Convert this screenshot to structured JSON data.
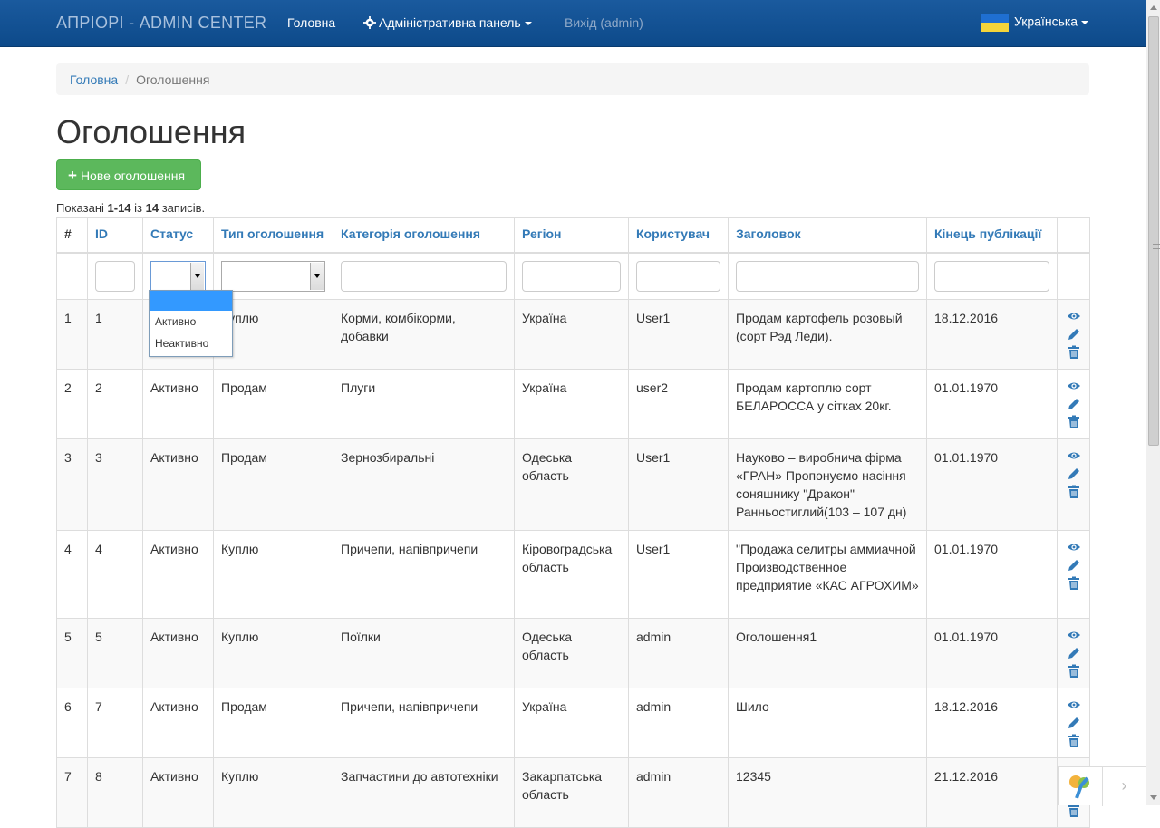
{
  "navbar": {
    "brand": "АПРІОРІ - ADMIN CENTER",
    "home": "Головна",
    "admin_panel": "Адміністративна панель",
    "logout": "Вихід (admin)",
    "language": "Українська"
  },
  "breadcrumb": {
    "home": "Головна",
    "current": "Оголошення"
  },
  "page_title": "Оголошення",
  "new_button": "Нове оголошення",
  "summary": {
    "prefix": "Показані ",
    "range": "1-14",
    "mid": " із ",
    "total": "14",
    "suffix": " записів."
  },
  "columns": [
    "#",
    "ID",
    "Статус",
    "Тип оголошення",
    "Категорія оголошення",
    "Регіон",
    "Користувач",
    "Заголовок",
    "Кінець публікації"
  ],
  "status_dropdown": {
    "options": [
      "",
      "Активно",
      "Неактивно"
    ]
  },
  "rows": [
    {
      "num": "1",
      "id": "1",
      "status": "",
      "type": "Куплю",
      "category": "Корми, комбікорми, добавки",
      "region": "Україна",
      "user": "User1",
      "title": "Продам картофель розовый (сорт Рэд Леди).",
      "end": "18.12.2016"
    },
    {
      "num": "2",
      "id": "2",
      "status": "Активно",
      "type": "Продам",
      "category": "Плуги",
      "region": "Україна",
      "user": "user2",
      "title": "Продам картоплю сорт БЕЛАРОССА у сітках 20кг.",
      "end": "01.01.1970"
    },
    {
      "num": "3",
      "id": "3",
      "status": "Активно",
      "type": "Продам",
      "category": "Зернозбиральні",
      "region": "Одеська область",
      "user": "User1",
      "title": "Науково – виробнича фірма «ГРАН» Пропонуємо насіння соняшнику \"Дракон\" Ранньостиглий(103 – 107 дн)",
      "end": "01.01.1970"
    },
    {
      "num": "4",
      "id": "4",
      "status": "Активно",
      "type": "Куплю",
      "category": "Причепи, напівпричепи",
      "region": "Кіровоградська область",
      "user": "User1",
      "title": "\"Продажа селитры аммиачной Производственное предприятие «КАС АГРОХИМ»",
      "end": "01.01.1970"
    },
    {
      "num": "5",
      "id": "5",
      "status": "Активно",
      "type": "Куплю",
      "category": "Поїлки",
      "region": "Одеська область",
      "user": "admin",
      "title": "Оголошення1",
      "end": "01.01.1970"
    },
    {
      "num": "6",
      "id": "7",
      "status": "Активно",
      "type": "Продам",
      "category": "Причепи, напівпричепи",
      "region": "Україна",
      "user": "admin",
      "title": "Шило",
      "end": "18.12.2016"
    },
    {
      "num": "7",
      "id": "8",
      "status": "Активно",
      "type": "Куплю",
      "category": "Запчастини до автотехніки",
      "region": "Закарпатська область",
      "user": "admin",
      "title": "12345",
      "end": "21.12.2016"
    }
  ],
  "icons": {
    "view": "eye-icon",
    "edit": "pencil-icon",
    "delete": "trash-icon",
    "settings": "gear-icon"
  },
  "colors": {
    "navbar": "#0d4a8a",
    "link": "#337ab7",
    "success": "#5cb85c",
    "active_status": "#3c763d"
  }
}
